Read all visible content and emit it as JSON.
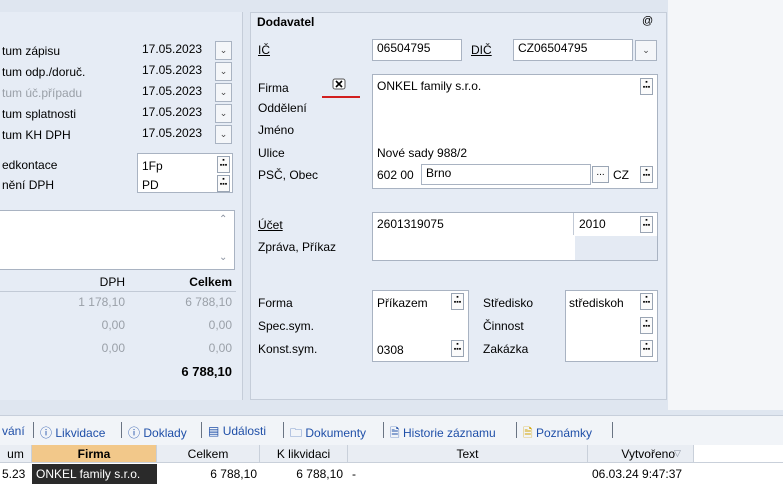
{
  "left": {
    "dates": [
      {
        "label": "tum zápisu",
        "value": "17.05.2023"
      },
      {
        "label": "tum odp./doruč.",
        "value": "17.05.2023"
      },
      {
        "label": "tum úč.případu",
        "value": "17.05.2023"
      },
      {
        "label": "tum splatnosti",
        "value": "17.05.2023"
      },
      {
        "label": "tum KH DPH",
        "value": "17.05.2023"
      }
    ],
    "predkontace_label": "edkontace",
    "predkontace_value": "1Fp",
    "cleneni_label": "nění DPH",
    "cleneni_value": "PD",
    "totals_header": {
      "dph": "DPH",
      "celkem": "Celkem"
    },
    "totals_rows": [
      {
        "dph": "1 178,10",
        "celkem": "6 788,10"
      },
      {
        "dph": "0,00",
        "celkem": "0,00"
      },
      {
        "dph": "0,00",
        "celkem": "0,00"
      }
    ],
    "grand_total": "6 788,10"
  },
  "supplier": {
    "title": "Dodavatel",
    "at_symbol": "@",
    "ic_label": "IČ",
    "ic_value": "06504795",
    "dic_label": "DIČ",
    "dic_value": "CZ06504795",
    "firma_label": "Firma",
    "oddeleni_label": "Oddělení",
    "jmeno_label": "Jméno",
    "ulice_label": "Ulice",
    "psc_label": "PSČ, Obec",
    "firma_value": "ONKEL family s.r.o.",
    "ulice_value": "Nové sady 988/2",
    "psc_value": "602 00",
    "obec_value": "Brno",
    "country": "CZ",
    "ucet_label": "Účet",
    "ucet_value": "2601319075",
    "bank_code": "2010",
    "zprava_label": "Zpráva, Příkaz",
    "forma_label": "Forma",
    "forma_value": "Příkazem",
    "spec_label": "Spec.sym.",
    "konst_label": "Konst.sym.",
    "konst_value": "0308",
    "stredisko_label": "Středisko",
    "stredisko_value": "střediskoh",
    "cinnost_label": "Činnost",
    "zakazka_label": "Zakázka"
  },
  "tabs": [
    {
      "label": "vání"
    },
    {
      "icon": "info-icon",
      "label": "Likvidace"
    },
    {
      "icon": "info-icon",
      "label": "Doklady"
    },
    {
      "icon": "list-icon",
      "label": "Události"
    },
    {
      "icon": "folder-icon",
      "label": "Dokumenty"
    },
    {
      "icon": "document-icon",
      "label": "Historie záznamu"
    },
    {
      "icon": "note-icon",
      "label": "Poznámky"
    }
  ],
  "grid": {
    "headers": [
      "um",
      "Firma",
      "Celkem",
      "K likvidaci",
      "Text",
      "Vytvořeno"
    ],
    "row": [
      "5.23",
      "ONKEL family s.r.o.",
      "6 788,10",
      "6 788,10",
      "-",
      "06.03.24 9:47:37"
    ]
  }
}
